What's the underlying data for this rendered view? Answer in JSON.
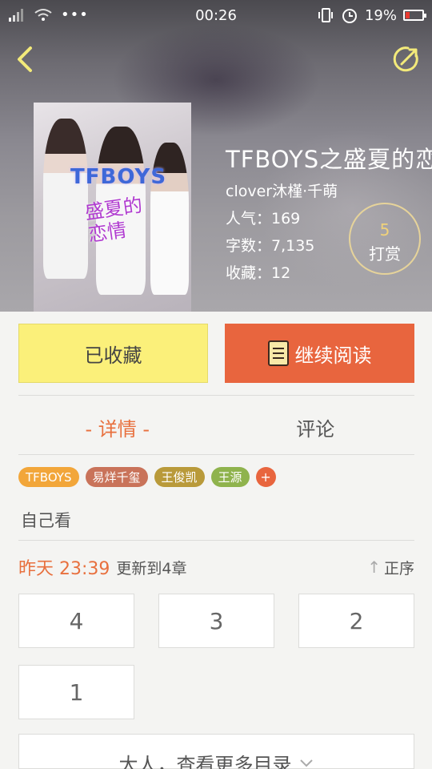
{
  "status_bar": {
    "time": "00:26",
    "battery": "19%",
    "icons": [
      "signal-icon",
      "wifi-icon",
      "more-dots-icon",
      "vibrate-icon",
      "alarm-icon",
      "battery-icon"
    ]
  },
  "nav": {
    "back_icon": "chevron-left-icon",
    "share_icon": "share-icon"
  },
  "book": {
    "title": "TFBOYS之盛夏的恋",
    "author": "clover沐槿·千萌",
    "popularity": "人气：169",
    "word_count": "字数：7,135",
    "favorites": "收藏：12",
    "cover_logo": "TFBOYS",
    "cover_subtitle": "盛夏的恋情"
  },
  "tip": {
    "count": "5",
    "label": "打赏"
  },
  "actions": {
    "favorited_label": "已收藏",
    "continue_label": "继续阅读"
  },
  "tabs": [
    {
      "label": "- 详情 -",
      "active": true
    },
    {
      "label": "评论",
      "active": false
    }
  ],
  "tags": [
    {
      "label": "TFBOYS",
      "color": "#f2a63a"
    },
    {
      "label": "易烊千玺",
      "color": "#c9735a"
    },
    {
      "label": "王俊凯",
      "color": "#b99a3a"
    },
    {
      "label": "王源",
      "color": "#8fb34d"
    }
  ],
  "tag_add": "+",
  "description": "自己看",
  "update": {
    "time": "昨天 23:39",
    "text": "更新到4章",
    "order_label": "正序"
  },
  "chapters": [
    "4",
    "3",
    "2",
    "1"
  ],
  "more_label": "大人，查看更多目录",
  "colors": {
    "accent": "#e8653e",
    "favorite_bg": "#fbf07a"
  }
}
